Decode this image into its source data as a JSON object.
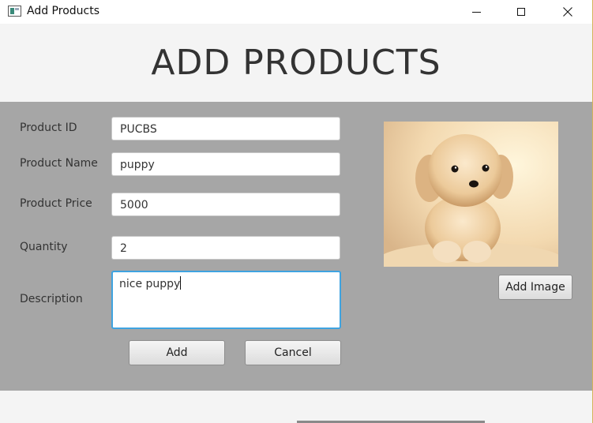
{
  "window": {
    "title": "Add Products"
  },
  "header": {
    "title": "ADD PRODUCTS"
  },
  "form": {
    "product_id": {
      "label": "Product ID",
      "value": "PUCBS"
    },
    "product_name": {
      "label": "Product Name",
      "value": "puppy"
    },
    "product_price": {
      "label": "Product Price",
      "value": "5000"
    },
    "quantity": {
      "label": "Quantity",
      "value": "2"
    },
    "description": {
      "label": "Description",
      "value": "nice puppy"
    }
  },
  "buttons": {
    "add": "Add",
    "cancel": "Cancel",
    "add_image": "Add Image"
  },
  "image": {
    "subject": "puppy-photo"
  },
  "colors": {
    "panel": "#a6a6a6",
    "focus_border": "#3fa3e0",
    "background": "#f4f4f4"
  }
}
